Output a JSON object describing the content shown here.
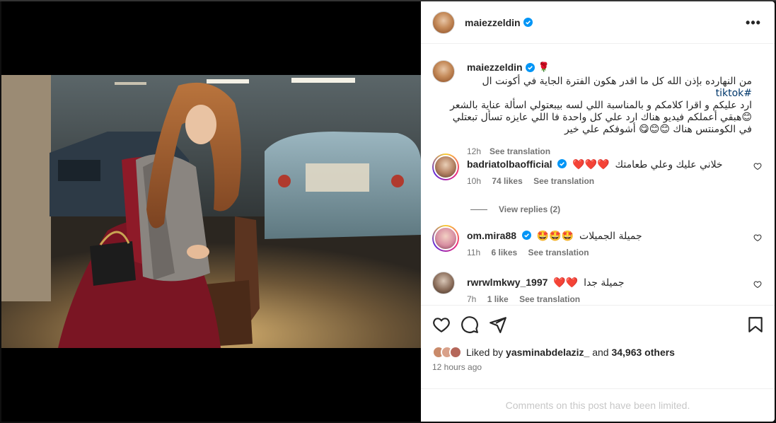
{
  "post": {
    "author": "maiezzeldin",
    "more_icon": "•••",
    "caption": {
      "emoji": "🌹",
      "line1": "من النهارده بإذن الله كل ما اقدر هكون الفترة الجاية في أكونت ال",
      "hashtag": "#tiktok",
      "line2": "ارد عليكم و اقرا كلامكم و بالمناسبة اللي لسه بيبعتولي اسألة عناية بالشعر",
      "line3": "هبقي أعملكم فيديو هناك ارد علي كل واحدة فا اللي عايزه تسأل تبعتلي",
      "line4": "في الكومنتس هناك",
      "line4_emoji": "😊😊😋",
      "line4_end": "أشوفكم علي خير",
      "line3_emoji": "😊",
      "time": "12h",
      "translate": "See translation"
    },
    "comments": [
      {
        "user": "badriatolbaofficial",
        "text": "خلاني عليك وعلي طعامتك",
        "emoji": "❤️❤️❤️",
        "time": "10h",
        "likes": "74 likes",
        "translate": "See translation"
      },
      {
        "user": "om.mira88",
        "text": "جميلة الجميلات",
        "emoji": "🤩🤩🤩",
        "time": "11h",
        "likes": "6 likes",
        "translate": "See translation"
      },
      {
        "user": "rwrwlmkwy_1997",
        "text": "جميلة جدا",
        "emoji": "❤️❤️",
        "time": "7h",
        "likes": "1 like",
        "translate": "See translation"
      }
    ],
    "view_replies": "View replies (2)",
    "liked_by_prefix": "Liked by",
    "liked_by_user": "yasminabdelaziz_",
    "liked_by_and": "and",
    "liked_by_others": "34,963 others",
    "time_ago": "12 hours ago",
    "comments_limited": "Comments on this post have been limited."
  },
  "colors": {
    "verified": "#0095f6",
    "link": "#00376b",
    "muted": "#737373",
    "limited": "#c7c7c7"
  },
  "icons": [
    "verified-icon",
    "more-icon",
    "heart-icon",
    "comment-icon",
    "share-icon",
    "save-icon"
  ]
}
